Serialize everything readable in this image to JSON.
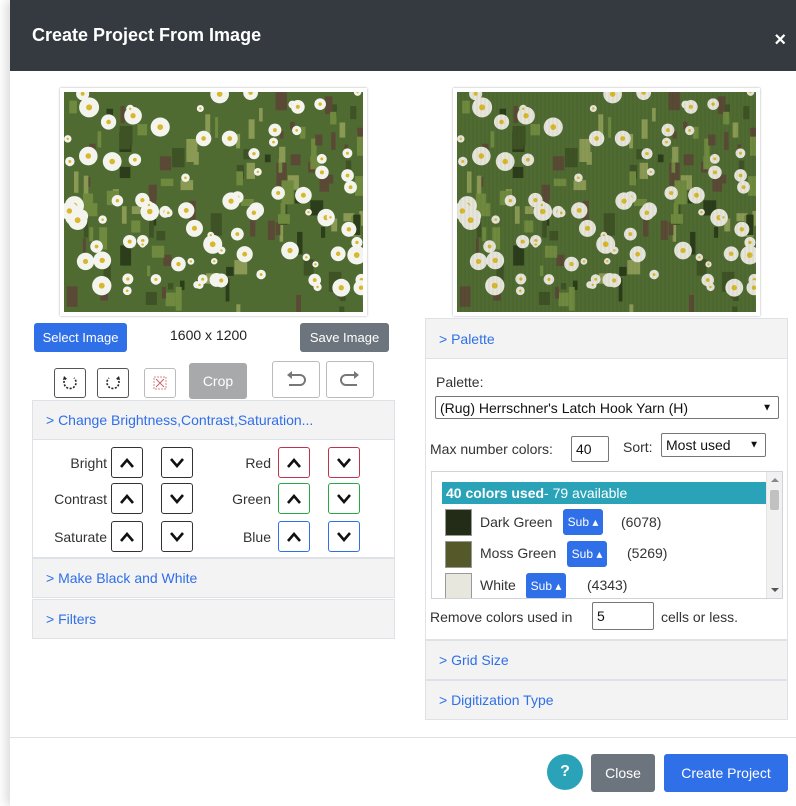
{
  "dialog": {
    "title": "Create Project From Image",
    "close_symbol": "×"
  },
  "left": {
    "select_image_label": "Select Image",
    "dimensions": "1600 x 1200",
    "save_image_label": "Save Image",
    "crop_label": "Crop",
    "adjust_panel": {
      "title": "> Change Brightness,Contrast,Saturation...",
      "rows": [
        {
          "left_label": "Bright",
          "right_label": "Red"
        },
        {
          "left_label": "Contrast",
          "right_label": "Green"
        },
        {
          "left_label": "Saturate",
          "right_label": "Blue"
        }
      ]
    },
    "bw_panel_title": "> Make Black and White",
    "filters_panel_title": "> Filters"
  },
  "right": {
    "palette_panel_title": "> Palette",
    "palette_label": "Palette:",
    "palette_selected": "(Rug) Herrschner's Latch Hook Yarn (H)",
    "max_colors_label": "Max number colors:",
    "max_colors_value": "40",
    "sort_label": "Sort:",
    "sort_selected": "Most used",
    "colors_used_bold": "40 colors used",
    "colors_available": " - 79 available",
    "colors": [
      {
        "name": "Dark Green",
        "sub_label": "Sub ▴",
        "count": "(6078)",
        "hex": "#222c17"
      },
      {
        "name": "Moss Green",
        "sub_label": "Sub ▴",
        "count": "(5269)",
        "hex": "#55592a"
      },
      {
        "name": "White",
        "sub_label": "Sub ▴",
        "count": "(4343)",
        "hex": "#e8e7dd"
      }
    ],
    "remove_prefix": "Remove colors used in",
    "remove_value": "5",
    "remove_suffix": "cells or less.",
    "grid_size_title": "> Grid Size",
    "digitization_title": "> Digitization Type"
  },
  "footer": {
    "help_label": "?",
    "close_label": "Close",
    "create_label": "Create Project"
  },
  "colors": {
    "header_bg": "#343a40",
    "primary": "#2f6fe8",
    "info": "#2aa3b8",
    "secondary": "#6c757d"
  }
}
